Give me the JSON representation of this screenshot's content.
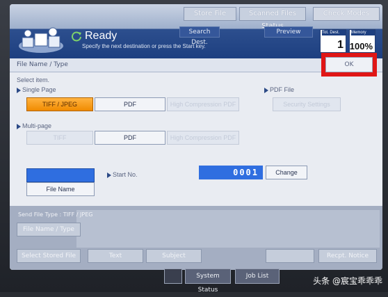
{
  "header": {
    "top_buttons": [
      "Store File",
      "Scanned Files Status",
      "Check Modes"
    ],
    "status": "Ready",
    "hint": "Specify the next destination or press the Start key.",
    "mid_buttons": [
      "Search Dest.",
      "Preview"
    ],
    "tot_dest_label": "Tot. Dest.",
    "tot_dest_value": "1",
    "memory_label": "Memory",
    "memory_value": "100%"
  },
  "panel": {
    "title": "File Name / Type",
    "ok_label": "OK",
    "select_item": "Select item.",
    "single_page": "Single Page",
    "multi_page": "Multi-page",
    "pdf_file": "PDF File",
    "single_options": [
      "TIFF / JPEG",
      "PDF",
      "High Compression PDF"
    ],
    "multi_options": [
      "TIFF",
      "PDF",
      "High Compression PDF"
    ],
    "security_settings": "Security Settings",
    "file_name_button": "File Name",
    "start_no_label": "Start No.",
    "start_no_value": "0001",
    "change_button": "Change"
  },
  "bottom": {
    "send_file_type": "Send File Type : TIFF / JPEG",
    "file_name_type": "File Name / Type",
    "select_stored_file": "Select Stored File",
    "text": "Text",
    "subject": "Subject",
    "recent_notice": "Recpt. Notice"
  },
  "footer": {
    "system_status": "System Status",
    "job_list": "Job List"
  },
  "watermark": "头条 @宸宝乖乖乖"
}
